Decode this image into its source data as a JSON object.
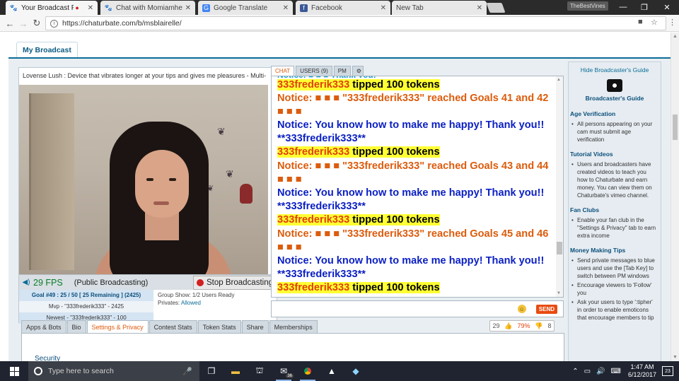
{
  "browser": {
    "tabs": [
      {
        "title": "Your Broadcast Page!",
        "icon": "chaturbate-icon",
        "recording": true
      },
      {
        "title": "Chat with Momiamhere",
        "icon": "chaturbate-icon"
      },
      {
        "title": "Google Translate",
        "icon": "google-translate-icon"
      },
      {
        "title": "Facebook",
        "icon": "facebook-icon"
      },
      {
        "title": "New Tab",
        "icon": ""
      }
    ],
    "profile_label": "TheBestVines",
    "url": "https://chaturbate.com/b/msblairelle/"
  },
  "page": {
    "section_tab": "My Broadcast",
    "video": {
      "title": "Lovense Lush : Device that vibrates longer at your tips and gives me pleasures - Multi-",
      "fps": "29 FPS",
      "status": "(Public Broadcasting)",
      "stop_label": "Stop Broadcasting"
    },
    "goal": {
      "line1": "Goal #49 : 25 / 50 [ 25 Remaining ] (2425)",
      "line2": "Mvp - \"333frederik333\" - 2425",
      "line3": "Newest - \"333frederik333\" - 100"
    },
    "group_show": {
      "line1": "Group Show: 1/2 Users Ready",
      "privates_label": "Privates:",
      "privates_value": "Allowed"
    },
    "chat_tabs": [
      "CHAT",
      "USERS (9)",
      "PM"
    ],
    "chat_messages": [
      {
        "type": "partial",
        "text": "Notice: ■ ■ ■ Thank you!"
      },
      {
        "type": "tip",
        "user": "333frederik333",
        "text": " tipped 100 tokens"
      },
      {
        "type": "notice",
        "text": "Notice: ■ ■ ■ \"333frederik333\" reached Goals 41 and 42 ■ ■ ■"
      },
      {
        "type": "thanks",
        "text": "Notice: You know how to make me happy! Thank you!! **333frederik333**"
      },
      {
        "type": "tip",
        "user": "333frederik333",
        "text": " tipped 100 tokens"
      },
      {
        "type": "notice",
        "text": "Notice: ■ ■ ■ \"333frederik333\" reached Goals 43 and 44 ■ ■ ■"
      },
      {
        "type": "thanks",
        "text": "Notice: You know how to make me happy! Thank you!! **333frederik333**"
      },
      {
        "type": "tip",
        "user": "333frederik333",
        "text": " tipped 100 tokens"
      },
      {
        "type": "notice",
        "text": "Notice: ■ ■ ■ \"333frederik333\" reached Goals 45 and 46 ■ ■ ■"
      },
      {
        "type": "thanks",
        "text": "Notice: You know how to make me happy! Thank you!! **333frederik333**"
      },
      {
        "type": "tip",
        "user": "333frederik333",
        "text": " tipped 100 tokens"
      }
    ],
    "chat_input": {
      "value": "",
      "placeholder": ""
    },
    "send_label": "SEND",
    "bottom_tabs": [
      "Apps & Bots",
      "Bio",
      "Settings & Privacy",
      "Contest Stats",
      "Token Stats",
      "Share",
      "Memberships"
    ],
    "active_bottom_tab": "Settings & Privacy",
    "satisfaction": {
      "up": "29",
      "pct": "79%",
      "down": "8"
    },
    "security_heading": "Security",
    "sidebar": {
      "hide_guide": "Hide Broadcaster's Guide",
      "guide_title": "Broadcaster's Guide",
      "sections": [
        {
          "title": "Age Verification",
          "items": [
            "All persons appearing on your cam must submit age verification"
          ]
        },
        {
          "title": "Tutorial Videos",
          "items": [
            "Users and broadcasters have created videos to teach you how to Chaturbate and earn money. You can view them on Chaturbate's vimeo channel."
          ]
        },
        {
          "title": "Fan Clubs",
          "items": [
            "Enable your fan club in the \"Settings & Privacy\" tab to earn extra income"
          ]
        },
        {
          "title": "Money Making Tips",
          "items": [
            "Send private messages to blue users and use the [Tab Key] to switch between PM windows",
            "Encourage viewers to 'Follow' you",
            "Ask your users to type ':tipher' in order to enable emoticons that encourage members to tip"
          ]
        }
      ]
    }
  },
  "taskbar": {
    "search_placeholder": "Type here to search",
    "mail_badge": "36",
    "time": "1:47 AM",
    "date": "6/12/2017",
    "notifications": "23"
  },
  "colors": {
    "accent": "#0b6d98",
    "tip_highlight": "#ffff33",
    "notice": "#dc5c0d",
    "thanks": "#0a1fc3",
    "send": "#e84b0f"
  }
}
